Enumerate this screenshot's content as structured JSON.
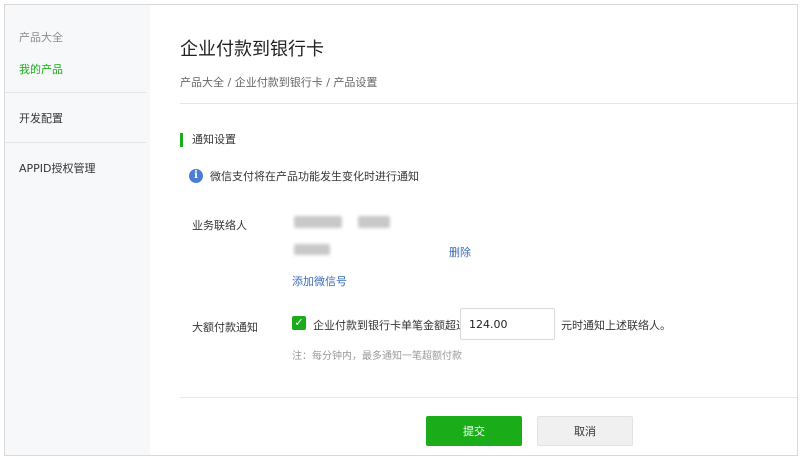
{
  "sidebar": {
    "items": [
      {
        "label": "产品大全"
      },
      {
        "label": "我的产品"
      },
      {
        "label": "开发配置"
      },
      {
        "label": "APPID授权管理"
      }
    ]
  },
  "page": {
    "title": "企业付款到银行卡",
    "breadcrumb": "产品大全 / 企业付款到银行卡 / 产品设置"
  },
  "section": {
    "title": "通知设置",
    "info_icon": "info-icon",
    "notice": "微信支付将在产品功能发生变化时进行通知"
  },
  "contacts": {
    "label": "业务联络人",
    "delete_label": "删除",
    "add_label": "添加微信号"
  },
  "large_payment": {
    "label": "大额付款通知",
    "checked": true,
    "checkbox_label": "企业付款到银行卡单笔金额超过",
    "amount": "124.00",
    "after_label": "元时通知上述联络人。",
    "note": "注：每分钟内，最多通知一笔超额付款"
  },
  "actions": {
    "submit_label": "提交",
    "cancel_label": "取消"
  },
  "colors": {
    "accent": "#1aad19",
    "link": "#3d6bb5",
    "info": "#4a7ed6"
  }
}
